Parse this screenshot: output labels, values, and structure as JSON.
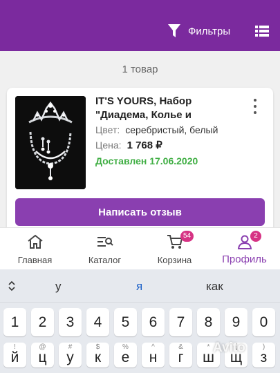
{
  "header": {
    "filter_label": "Фильтры",
    "filter_icon": "funnel-icon",
    "list_icon": "list-view-icon",
    "bg_color": "#7b2a9e"
  },
  "results": {
    "count_text": "1 товар"
  },
  "order": {
    "title": "IT'S YOURS, Набор \"Диадема, Колье и",
    "color_label": "Цвет:",
    "color_value": "серебристый, белый",
    "price_label": "Цена:",
    "price_value": "1 768 ₽",
    "status": "Доставлен 17.06.2020",
    "review_button": "Написать отзыв"
  },
  "nav": {
    "items": [
      {
        "label": "Главная",
        "icon": "home-icon",
        "badge": ""
      },
      {
        "label": "Каталог",
        "icon": "catalog-search-icon",
        "badge": ""
      },
      {
        "label": "Корзина",
        "icon": "cart-icon",
        "badge": "54"
      },
      {
        "label": "Профиль",
        "icon": "profile-icon",
        "badge": "2"
      }
    ],
    "active_color": "#8a3fb0",
    "badge_color": "#d63384"
  },
  "keyboard": {
    "suggestions": [
      "у",
      "я",
      "как"
    ],
    "digits": [
      "1",
      "2",
      "3",
      "4",
      "5",
      "6",
      "7",
      "8",
      "9",
      "0"
    ],
    "letter_row": [
      {
        "key": "й",
        "hint": "!"
      },
      {
        "key": "ц",
        "hint": "@"
      },
      {
        "key": "у",
        "hint": "#"
      },
      {
        "key": "к",
        "hint": "$"
      },
      {
        "key": "е",
        "hint": "%"
      },
      {
        "key": "н",
        "hint": "^"
      },
      {
        "key": "г",
        "hint": "&"
      },
      {
        "key": "ш",
        "hint": "*"
      },
      {
        "key": "щ",
        "hint": "("
      },
      {
        "key": "з",
        "hint": ")"
      }
    ]
  },
  "watermark": "Avito"
}
